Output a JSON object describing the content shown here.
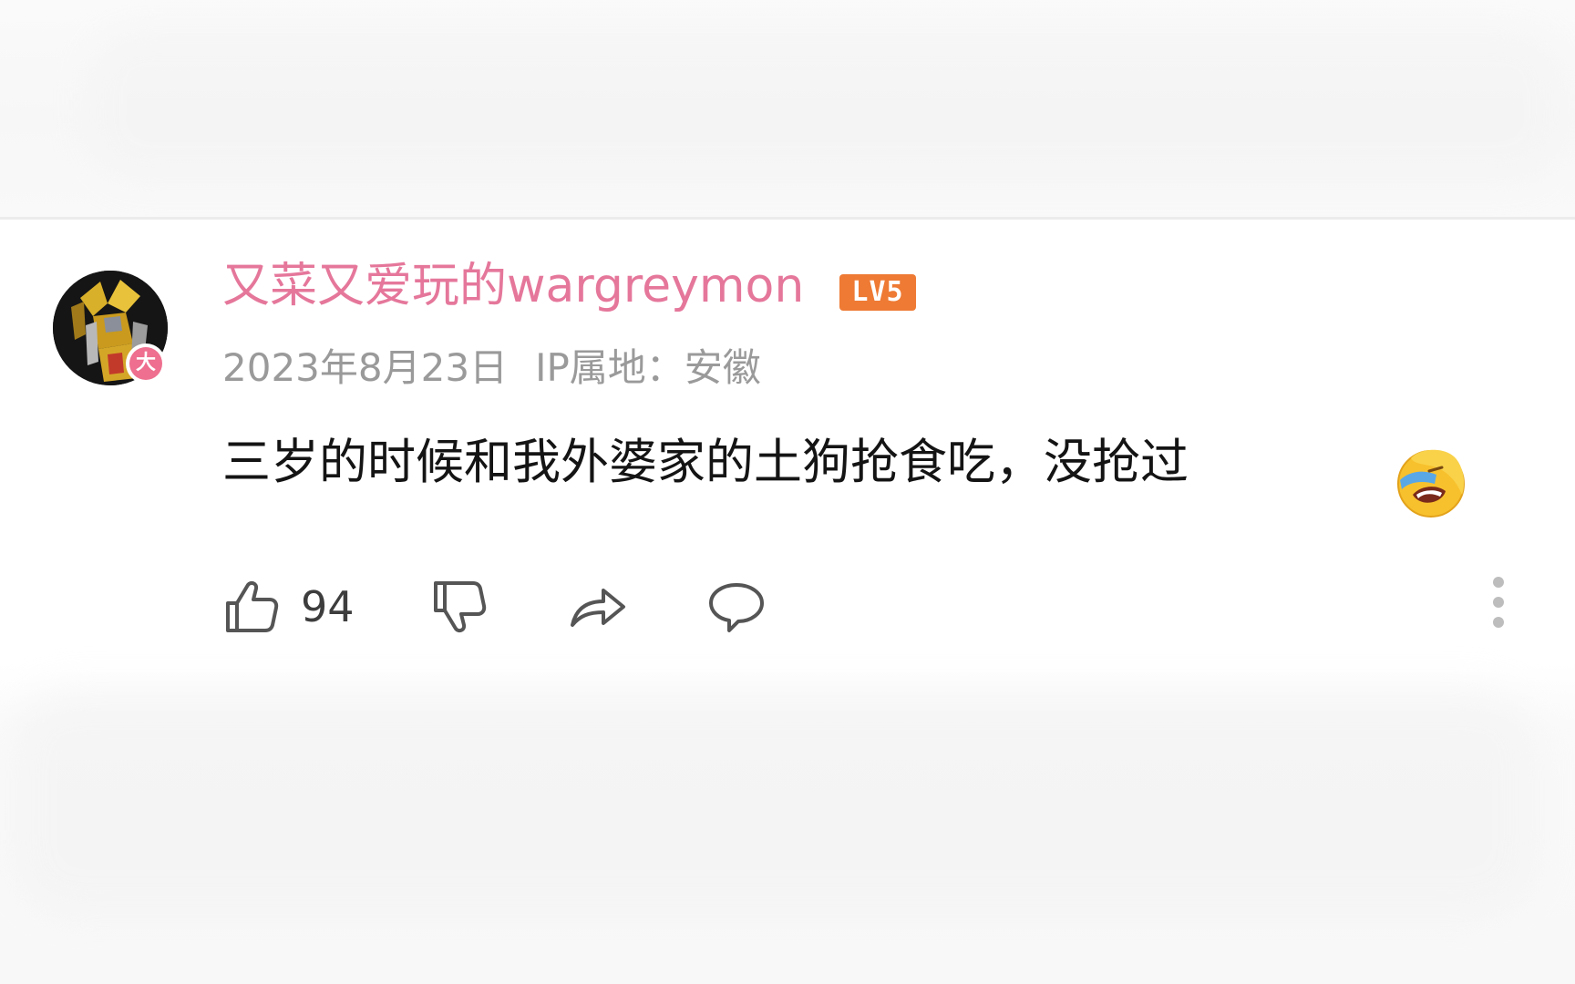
{
  "comment": {
    "username": "又菜又爱玩的wargreymon",
    "level_badge": "LV5",
    "avatar_badge": "大",
    "date": "2023年8月23日",
    "ip_location": "IP属地：安徽",
    "text": "三岁的时候和我外婆家的土狗抢食吃，没抢过",
    "emoji": "laughing-tears-emoji",
    "likes": "94"
  },
  "actions": {
    "like_icon": "thumbs-up-icon",
    "dislike_icon": "thumbs-down-icon",
    "share_icon": "share-icon",
    "reply_icon": "comment-bubble-icon",
    "more_icon": "more-vertical-icon"
  },
  "colors": {
    "username": "#e5779b",
    "level_badge": "#ee7a34",
    "avatar_badge": "#ee6f8f",
    "meta_text": "#9a9a9a",
    "body_text": "#141414",
    "icon": "#555555"
  }
}
